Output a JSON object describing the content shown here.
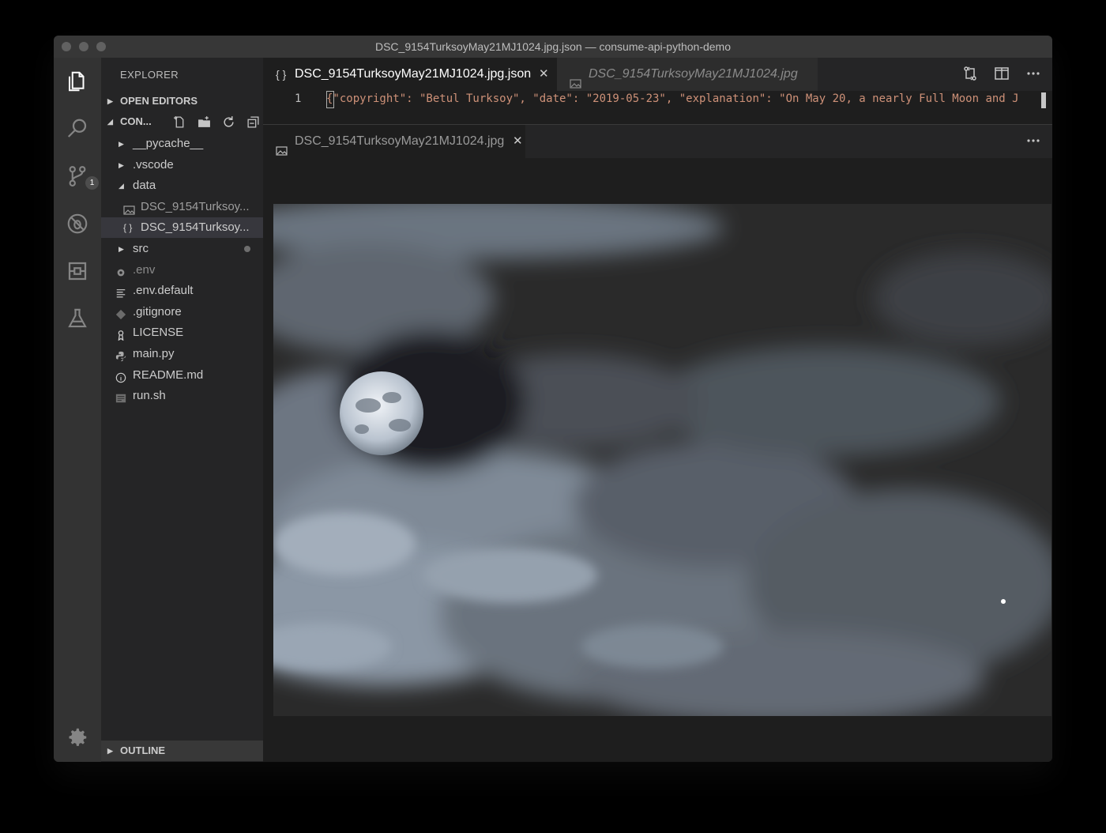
{
  "window": {
    "title": "DSC_9154TurksoyMay21MJ1024.jpg.json — consume-api-python-demo"
  },
  "activity_bar": {
    "items": [
      {
        "name": "explorer-icon"
      },
      {
        "name": "search-icon"
      },
      {
        "name": "source-control-icon",
        "badge": "1"
      },
      {
        "name": "debug-icon"
      },
      {
        "name": "extensions-icon"
      },
      {
        "name": "testing-flask-icon"
      }
    ],
    "bottom": {
      "name": "gear-icon"
    }
  },
  "sidebar": {
    "header": "EXPLORER",
    "open_editors_label": "OPEN EDITORS",
    "project_label": "CON...",
    "outline_label": "OUTLINE",
    "tree": [
      {
        "label": "__pycache__",
        "kind": "folder",
        "expanded": false,
        "depth": 1
      },
      {
        "label": ".vscode",
        "kind": "folder",
        "expanded": false,
        "depth": 1
      },
      {
        "label": "data",
        "kind": "folder",
        "expanded": true,
        "depth": 1
      },
      {
        "label": "DSC_9154Turksoy...",
        "kind": "image",
        "depth": 2
      },
      {
        "label": "DSC_9154Turksoy...",
        "kind": "json",
        "depth": 2,
        "selected": true
      },
      {
        "label": "src",
        "kind": "folder",
        "expanded": false,
        "depth": 1,
        "modified": true
      },
      {
        "label": ".env",
        "kind": "gear",
        "depth": 1,
        "dimmed": true
      },
      {
        "label": ".env.default",
        "kind": "lines",
        "depth": 1
      },
      {
        "label": ".gitignore",
        "kind": "git",
        "depth": 1
      },
      {
        "label": "LICENSE",
        "kind": "license",
        "depth": 1
      },
      {
        "label": "main.py",
        "kind": "python",
        "depth": 1
      },
      {
        "label": "README.md",
        "kind": "info",
        "depth": 1
      },
      {
        "label": "run.sh",
        "kind": "shell",
        "depth": 1
      }
    ]
  },
  "editor_group_1": {
    "tabs": [
      {
        "label": "DSC_9154TurksoyMay21MJ1024.jpg.json",
        "icon": "json-braces-icon",
        "active": true
      },
      {
        "label": "DSC_9154TurksoyMay21MJ1024.jpg",
        "icon": "image-file-icon",
        "active": false
      }
    ],
    "line_number": "1",
    "code_line": "{\"copyright\": \"Betul Turksoy\", \"date\": \"2019-05-23\", \"explanation\": \"On May 20, a nearly Full Moon and J"
  },
  "editor_group_2": {
    "tabs": [
      {
        "label": "DSC_9154TurksoyMay21MJ1024.jpg",
        "icon": "image-file-icon",
        "active": true
      }
    ]
  },
  "colors": {
    "background": "#1e1e1e",
    "sidebar": "#252526",
    "activity_bar": "#333333",
    "string": "#ce9178"
  }
}
